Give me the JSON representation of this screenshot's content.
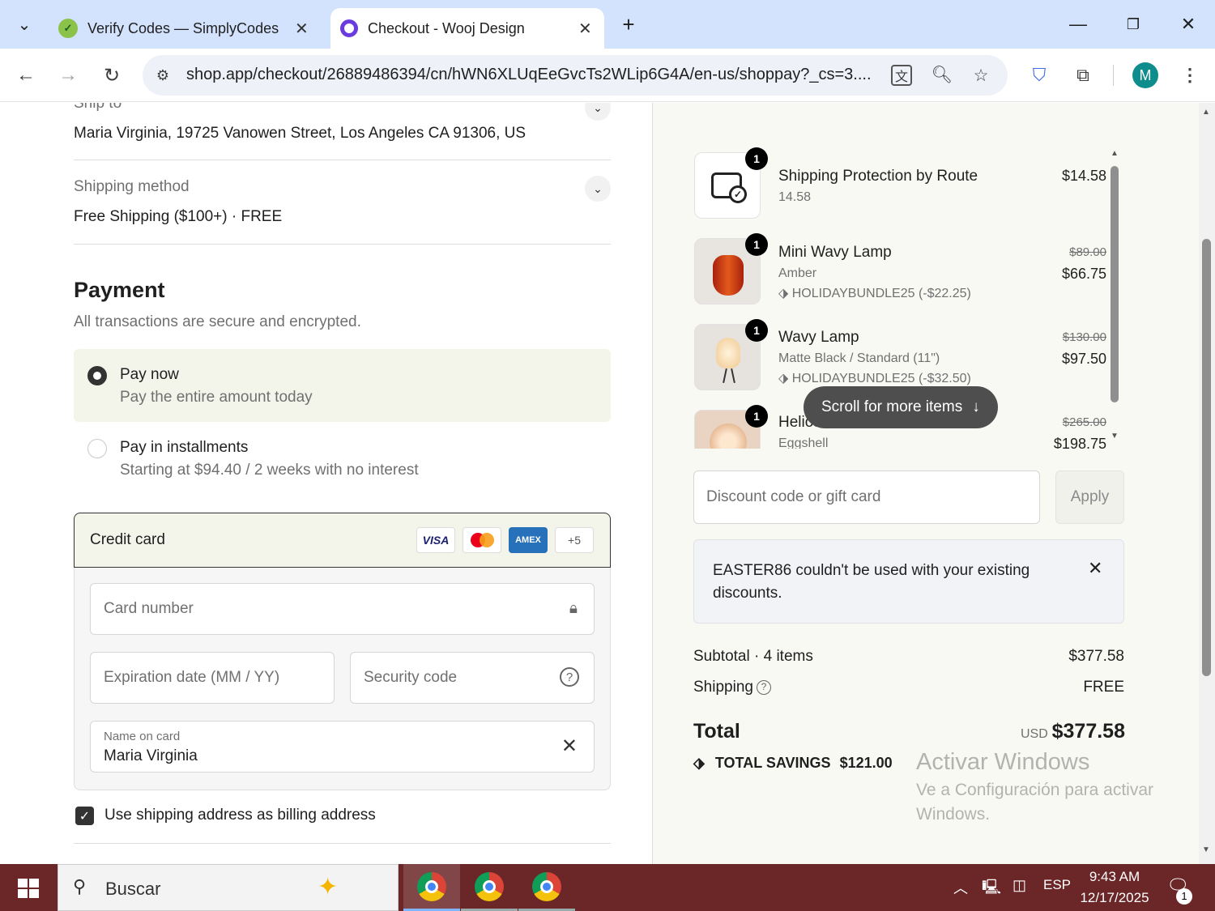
{
  "browser": {
    "tabs": [
      {
        "title": "Verify Codes — SimplyCodes",
        "active": false
      },
      {
        "title": "Checkout - Wooj Design",
        "active": true
      }
    ],
    "new_tab": "+",
    "url": "shop.app/checkout/26889486394/cn/hWN6XLUqEeGvcTs2WLip6G4A/en-us/shoppay?_cs=3....",
    "profile_initial": "M",
    "accent": "#0b57d0"
  },
  "shipping": {
    "ship_to_label": "Ship to",
    "ship_to_value": "Maria Virginia, 19725 Vanowen Street, Los Angeles CA 91306, US",
    "method_label": "Shipping method",
    "method_value": "Free Shipping ($100+) · FREE"
  },
  "payment": {
    "title": "Payment",
    "subtitle": "All transactions are secure and encrypted.",
    "options": [
      {
        "label": "Pay now",
        "desc": "Pay the entire amount today",
        "selected": true
      },
      {
        "label": "Pay in installments",
        "desc": "Starting at $94.40 / 2 weeks with no interest",
        "selected": false
      }
    ],
    "card_label": "Credit card",
    "card_brands": [
      "VISA",
      "Mastercard",
      "AMEX"
    ],
    "more_brands": "+5",
    "card_number_placeholder": "Card number",
    "expiry_placeholder": "Expiration date (MM / YY)",
    "security_placeholder": "Security code",
    "name_label": "Name on card",
    "name_value": "Maria Virginia",
    "billing_checkbox_label": "Use shipping address as billing address",
    "billing_checked": true
  },
  "order": {
    "items": [
      {
        "qty": "1",
        "name": "Shipping Protection by Route",
        "variant": "14.58",
        "discount": "",
        "original": "",
        "price": "$14.58"
      },
      {
        "qty": "1",
        "name": "Mini Wavy Lamp",
        "variant": "Amber",
        "discount": "HOLIDAYBUNDLE25 (-$22.25)",
        "original": "$89.00",
        "price": "$66.75"
      },
      {
        "qty": "1",
        "name": "Wavy Lamp",
        "variant": "Matte Black / Standard (11\")",
        "discount": "HOLIDAYBUNDLE25 (-$32.50)",
        "original": "$130.00",
        "price": "$97.50"
      },
      {
        "qty": "1",
        "name": "Helios",
        "variant": "Eggshell",
        "discount": "",
        "original": "$265.00",
        "price": "$198.75"
      }
    ],
    "scroll_hint": "Scroll for more items",
    "discount_placeholder": "Discount code or gift card",
    "apply_label": "Apply",
    "error_message": "EASTER86 couldn't be used with your existing discounts.",
    "subtotal_label": "Subtotal · 4 items",
    "subtotal_value": "$377.58",
    "shipping_label": "Shipping",
    "shipping_value": "FREE",
    "total_label": "Total",
    "currency": "USD",
    "total_value": "$377.58",
    "savings_label": "TOTAL SAVINGS",
    "savings_value": "$121.00"
  },
  "watermark": {
    "title": "Activar Windows",
    "line": "Ve a Configuración para activar Windows."
  },
  "taskbar": {
    "search_placeholder": "Buscar",
    "language": "ESP",
    "time": "9:43 AM",
    "date": "12/17/2025",
    "notifications": "1",
    "color": "#6b2628"
  }
}
